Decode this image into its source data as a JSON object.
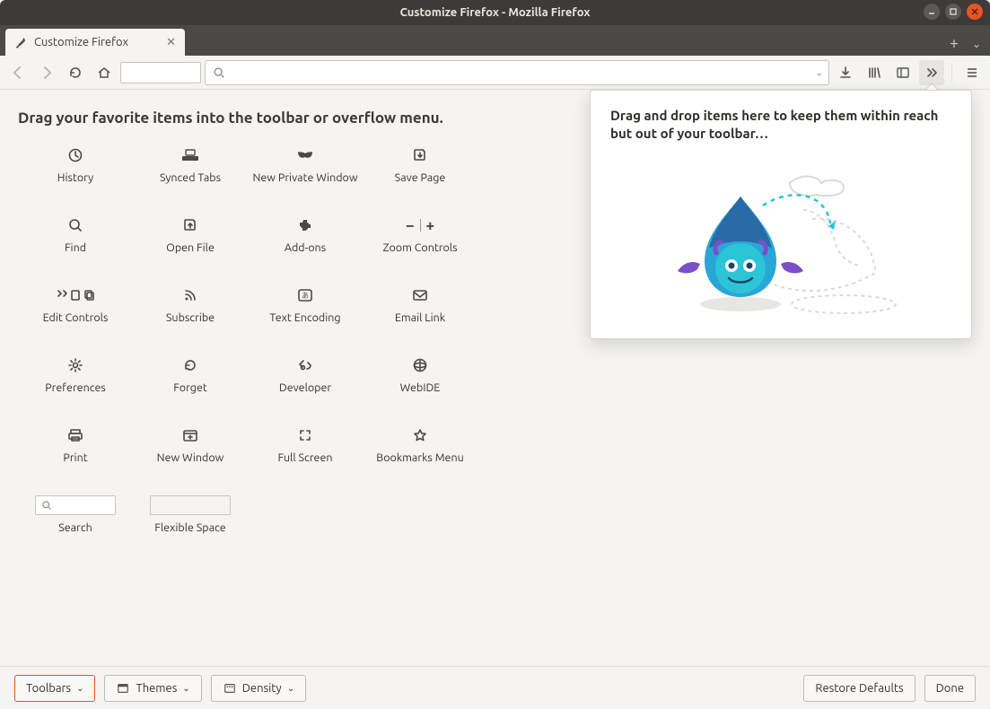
{
  "window": {
    "title": "Customize Firefox - Mozilla Firefox"
  },
  "tab": {
    "label": "Customize Firefox"
  },
  "navbar": {
    "downloads_tooltip": "Downloads",
    "library_tooltip": "Library",
    "sidebar_tooltip": "Sidebars",
    "overflow_tooltip": "More tools",
    "menu_tooltip": "Open menu"
  },
  "customize": {
    "heading": "Drag your favorite items into the toolbar or overflow menu.",
    "items": [
      {
        "label": "History",
        "icon": "history"
      },
      {
        "label": "Synced Tabs",
        "icon": "synced"
      },
      {
        "label": "New Private Window",
        "icon": "mask"
      },
      {
        "label": "Save Page",
        "icon": "save"
      },
      {
        "label": "Find",
        "icon": "find"
      },
      {
        "label": "Open File",
        "icon": "openfile"
      },
      {
        "label": "Add-ons",
        "icon": "addons"
      },
      {
        "label": "Zoom Controls",
        "icon": "zoom"
      },
      {
        "label": "Edit Controls",
        "icon": "edit"
      },
      {
        "label": "Subscribe",
        "icon": "rss"
      },
      {
        "label": "Text Encoding",
        "icon": "encoding"
      },
      {
        "label": "Email Link",
        "icon": "email"
      },
      {
        "label": "Preferences",
        "icon": "prefs"
      },
      {
        "label": "Forget",
        "icon": "forget"
      },
      {
        "label": "Developer",
        "icon": "dev"
      },
      {
        "label": "WebIDE",
        "icon": "webide"
      },
      {
        "label": "Print",
        "icon": "print"
      },
      {
        "label": "New Window",
        "icon": "newwin"
      },
      {
        "label": "Full Screen",
        "icon": "fullscreen"
      },
      {
        "label": "Bookmarks Menu",
        "icon": "bookmarks"
      },
      {
        "label": "Search",
        "icon": "searchbox"
      },
      {
        "label": "Flexible Space",
        "icon": "flexspace"
      }
    ]
  },
  "overflow": {
    "text": "Drag and drop items here to keep them within reach but out of your toolbar…"
  },
  "footer": {
    "toolbars": "Toolbars",
    "themes": "Themes",
    "density": "Density",
    "restore": "Restore Defaults",
    "done": "Done"
  }
}
